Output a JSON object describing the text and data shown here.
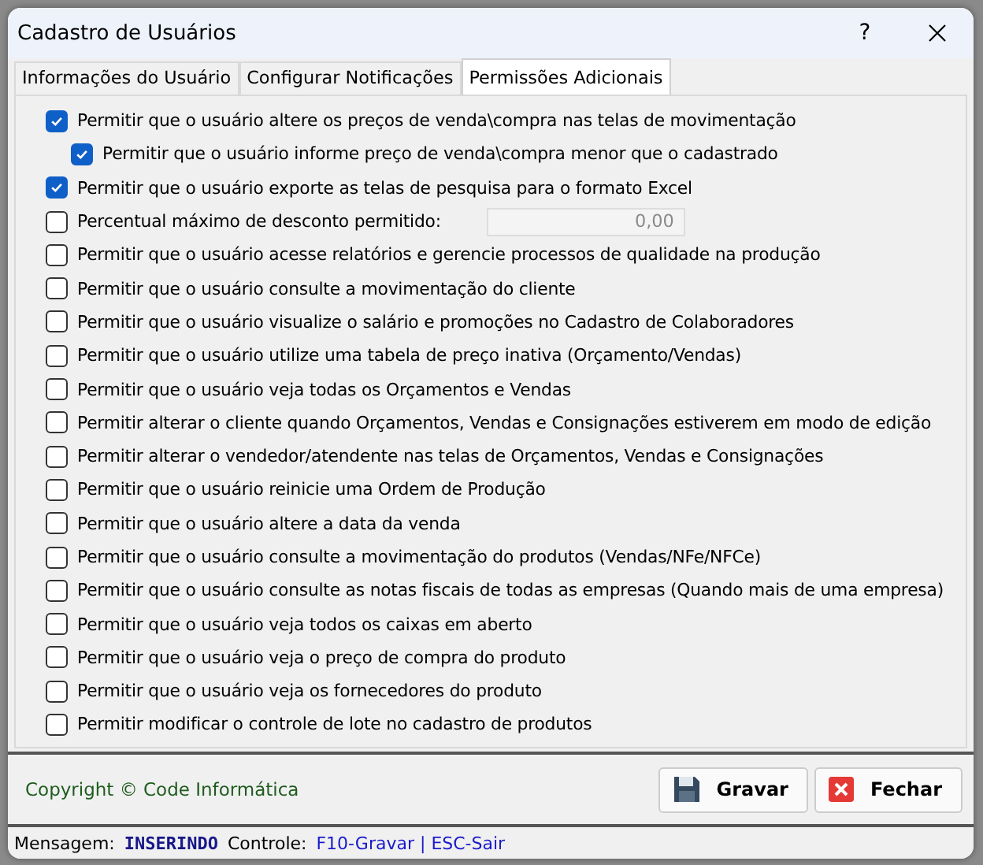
{
  "window": {
    "title": "Cadastro de Usuários",
    "help": "?"
  },
  "tabs": [
    {
      "label": "Informações do Usuário",
      "selected": false
    },
    {
      "label": "Configurar Notificações",
      "selected": false
    },
    {
      "label": "Permissões Adicionais",
      "selected": true
    }
  ],
  "permissions": [
    {
      "kind": "checkbox",
      "label": "Permitir que o usuário altere os preços de venda\\compra nas telas de movimentação",
      "checked": true,
      "children": [
        {
          "kind": "checkbox",
          "label": "Permitir que o usuário informe preço de venda\\compra menor que o cadastrado",
          "checked": true
        }
      ]
    },
    {
      "kind": "checkbox",
      "label": "Permitir que o usuário exporte as telas de pesquisa para o formato Excel",
      "checked": true
    },
    {
      "kind": "field",
      "label": "Percentual máximo de desconto permitido:",
      "checked": false,
      "value": "0,00",
      "disabled": true
    },
    {
      "kind": "checkbox",
      "label": "Permitir que o usuário acesse relatórios e gerencie processos de qualidade na produção",
      "checked": false
    },
    {
      "kind": "checkbox",
      "label": "Permitir que o usuário consulte a movimentação do cliente",
      "checked": false
    },
    {
      "kind": "checkbox",
      "label": "Permitir que o usuário visualize o salário e promoções no Cadastro de Colaboradores",
      "checked": false
    },
    {
      "kind": "checkbox",
      "label": "Permitir que o usuário utilize uma tabela de preço inativa (Orçamento/Vendas)",
      "checked": false
    },
    {
      "kind": "checkbox",
      "label": "Permitir que o usuário veja todas os Orçamentos e Vendas",
      "checked": false
    },
    {
      "kind": "checkbox",
      "label": "Permitir alterar o cliente quando Orçamentos, Vendas e Consignações estiverem em modo de edição",
      "checked": false
    },
    {
      "kind": "checkbox",
      "label": "Permitir alterar o vendedor/atendente nas telas de Orçamentos, Vendas e Consignações",
      "checked": false
    },
    {
      "kind": "checkbox",
      "label": "Permitir que o usuário reinicie uma Ordem de Produção",
      "checked": false
    },
    {
      "kind": "checkbox",
      "label": "Permitir que o usuário altere a data da venda",
      "checked": false
    },
    {
      "kind": "checkbox",
      "label": "Permitir que o usuário consulte a movimentação do produtos (Vendas/NFe/NFCe)",
      "checked": false
    },
    {
      "kind": "checkbox",
      "label": "Permitir que o usuário consulte as notas fiscais de todas as empresas (Quando mais de uma empresa)",
      "checked": false
    },
    {
      "kind": "checkbox",
      "label": "Permitir que o usuário veja todos os caixas em aberto",
      "checked": false
    },
    {
      "kind": "checkbox",
      "label": "Permitir que o usuário veja o preço de compra do produto",
      "checked": false
    },
    {
      "kind": "checkbox",
      "label": "Permitir que o usuário veja os fornecedores do produto",
      "checked": false
    },
    {
      "kind": "checkbox",
      "label": "Permitir modificar o controle de lote no cadastro de produtos",
      "checked": false
    }
  ],
  "footer": {
    "copyright": "Copyright © Code Informática",
    "buttons": [
      {
        "kind": "save",
        "label": "Gravar"
      },
      {
        "kind": "close",
        "label": "Fechar"
      }
    ]
  },
  "status_bar": {
    "message_label": "Mensagem:",
    "message": "INSERINDO",
    "control_label": "Controle:",
    "shortcuts": "F10-Gravar | ESC-Sair"
  }
}
